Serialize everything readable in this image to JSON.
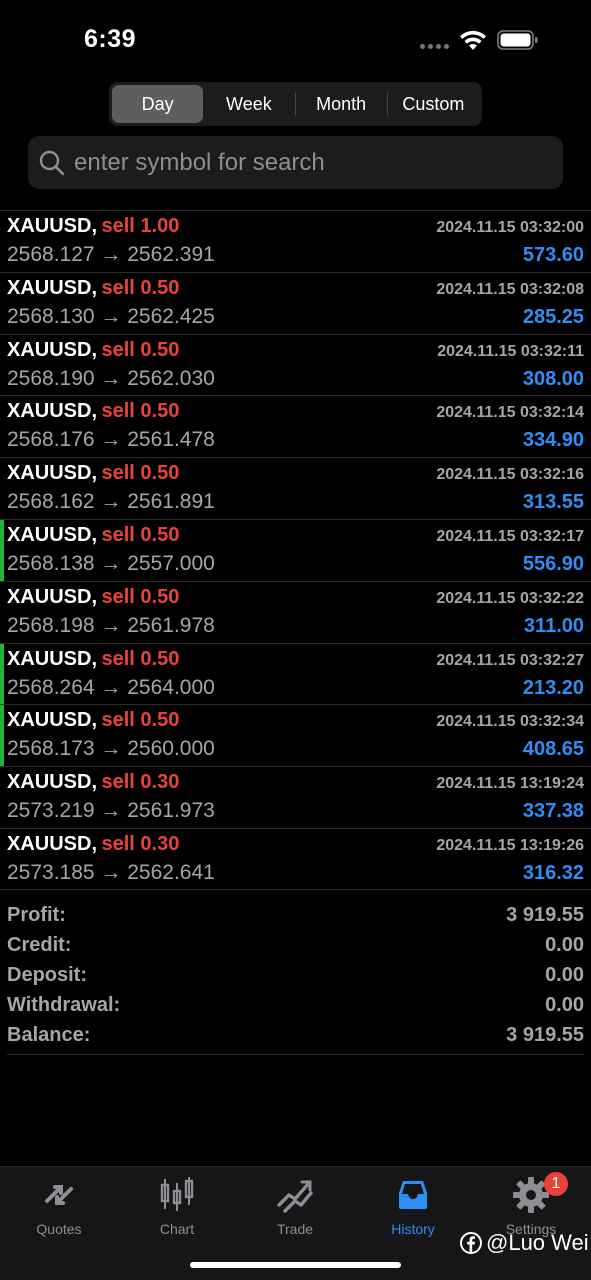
{
  "status": {
    "time": "6:39"
  },
  "segments": [
    {
      "label": "Day",
      "active": true
    },
    {
      "label": "Week",
      "active": false
    },
    {
      "label": "Month",
      "active": false
    },
    {
      "label": "Custom",
      "active": false
    }
  ],
  "search": {
    "placeholder": "enter symbol for search"
  },
  "trades": [
    {
      "symbol": "XAUUSD,",
      "side": "sell 1.00",
      "date": "2024.11.15 03:32:00",
      "prices": "2568.127 → 2562.391",
      "profit": "573.60",
      "marked": false
    },
    {
      "symbol": "XAUUSD,",
      "side": "sell 0.50",
      "date": "2024.11.15 03:32:08",
      "prices": "2568.130 → 2562.425",
      "profit": "285.25",
      "marked": false
    },
    {
      "symbol": "XAUUSD,",
      "side": "sell 0.50",
      "date": "2024.11.15 03:32:11",
      "prices": "2568.190 → 2562.030",
      "profit": "308.00",
      "marked": false
    },
    {
      "symbol": "XAUUSD,",
      "side": "sell 0.50",
      "date": "2024.11.15 03:32:14",
      "prices": "2568.176 → 2561.478",
      "profit": "334.90",
      "marked": false
    },
    {
      "symbol": "XAUUSD,",
      "side": "sell 0.50",
      "date": "2024.11.15 03:32:16",
      "prices": "2568.162 → 2561.891",
      "profit": "313.55",
      "marked": false
    },
    {
      "symbol": "XAUUSD,",
      "side": "sell 0.50",
      "date": "2024.11.15 03:32:17",
      "prices": "2568.138 → 2557.000",
      "profit": "556.90",
      "marked": true
    },
    {
      "symbol": "XAUUSD,",
      "side": "sell 0.50",
      "date": "2024.11.15 03:32:22",
      "prices": "2568.198 → 2561.978",
      "profit": "311.00",
      "marked": false
    },
    {
      "symbol": "XAUUSD,",
      "side": "sell 0.50",
      "date": "2024.11.15 03:32:27",
      "prices": "2568.264 → 2564.000",
      "profit": "213.20",
      "marked": true
    },
    {
      "symbol": "XAUUSD,",
      "side": "sell 0.50",
      "date": "2024.11.15 03:32:34",
      "prices": "2568.173 → 2560.000",
      "profit": "408.65",
      "marked": true
    },
    {
      "symbol": "XAUUSD,",
      "side": "sell 0.30",
      "date": "2024.11.15 13:19:24",
      "prices": "2573.219 → 2561.973",
      "profit": "337.38",
      "marked": false
    },
    {
      "symbol": "XAUUSD,",
      "side": "sell 0.30",
      "date": "2024.11.15 13:19:26",
      "prices": "2573.185 → 2562.641",
      "profit": "316.32",
      "marked": false
    }
  ],
  "summary": [
    {
      "label": "Profit:",
      "value": "3 919.55"
    },
    {
      "label": "Credit:",
      "value": "0.00"
    },
    {
      "label": "Deposit:",
      "value": "0.00"
    },
    {
      "label": "Withdrawal:",
      "value": "0.00"
    },
    {
      "label": "Balance:",
      "value": "3 919.55"
    }
  ],
  "tabs": [
    {
      "label": "Quotes",
      "icon": "quotes-icon",
      "active": false
    },
    {
      "label": "Chart",
      "icon": "chart-icon",
      "active": false
    },
    {
      "label": "Trade",
      "icon": "trade-icon",
      "active": false
    },
    {
      "label": "History",
      "icon": "history-icon",
      "active": true
    },
    {
      "label": "Settings",
      "icon": "settings-icon",
      "active": false,
      "badge": "1"
    }
  ],
  "watermark": {
    "text": "@Luo Wei"
  },
  "colors": {
    "sell": "#e8433b",
    "profit": "#2f8ef4",
    "marker": "#1fb53a",
    "active_tab": "#2f8ef4"
  }
}
